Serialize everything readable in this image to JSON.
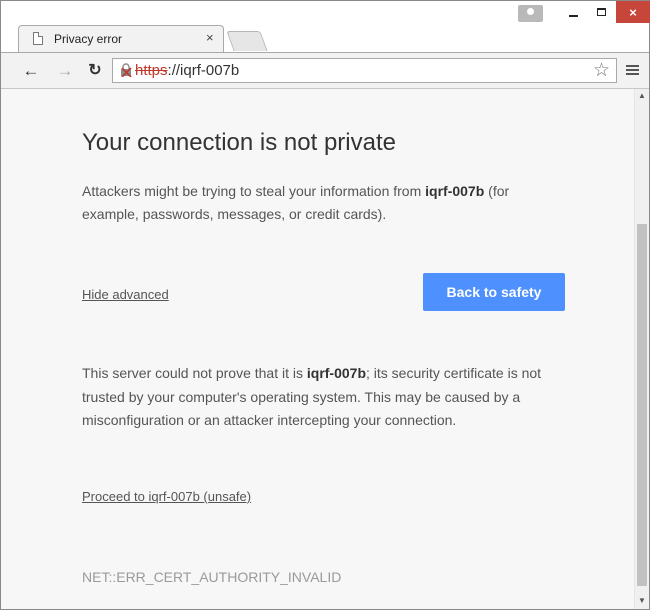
{
  "browser": {
    "tab_title": "Privacy error",
    "tab_close": "×",
    "close_glyph": "×",
    "url_scheme": "https",
    "url_rest": "://iqrf-007b",
    "icons": {
      "back": "back-arrow-icon",
      "forward": "forward-arrow-icon",
      "reload": "reload-icon",
      "security": "broken-lock-icon",
      "bookmark": "star-icon",
      "menu": "hamburger-menu-icon",
      "page": "page-icon",
      "user": "user-icon"
    },
    "colors": {
      "close_button": "#c7463c",
      "insecure_scheme": "#c0392b"
    }
  },
  "page": {
    "heading": "Your connection is not private",
    "desc_prefix": "Attackers might be trying to steal your information from ",
    "host": "iqrf-007b",
    "desc_suffix": " (for example, passwords, messages, or credit cards).",
    "hide_advanced": "Hide advanced",
    "back_button": "Back to safety",
    "details_prefix": "This server could not prove that it is ",
    "details_suffix": "; its security certificate is not trusted by your computer's operating system. This may be caused by a misconfiguration or an attacker intercepting your connection.",
    "proceed_link": "Proceed to iqrf-007b (unsafe)",
    "error_code": "NET::ERR_CERT_AUTHORITY_INVALID",
    "colors": {
      "primary_button": "#4d90fe",
      "background": "#f7f7f7"
    }
  }
}
